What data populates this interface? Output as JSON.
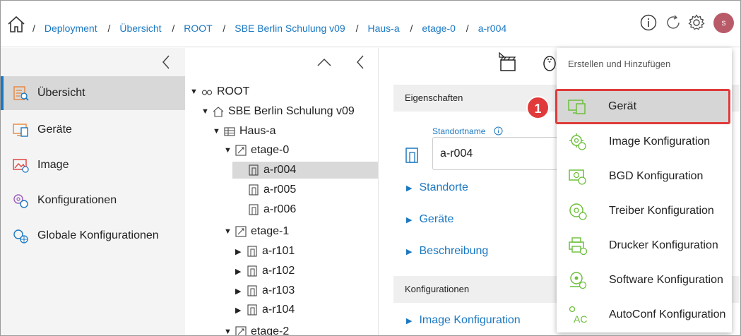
{
  "header": {
    "breadcrumb": [
      "Deployment",
      "Übersicht",
      "ROOT",
      "SBE Berlin Schulung v09",
      "Haus-a",
      "etage-0",
      "a-r004"
    ],
    "avatar_initial": "s"
  },
  "sidebar": {
    "items": [
      {
        "label": "Übersicht",
        "icon": "overview-icon",
        "active": true
      },
      {
        "label": "Geräte",
        "icon": "devices-icon"
      },
      {
        "label": "Image",
        "icon": "image-icon"
      },
      {
        "label": "Konfigurationen",
        "icon": "config-gears-icon"
      },
      {
        "label": "Globale Konfigurationen",
        "icon": "global-config-icon"
      }
    ]
  },
  "tree": {
    "root": "ROOT",
    "site": "SBE Berlin Schulung v09",
    "building": "Haus-a",
    "floor0": "etage-0",
    "f0rooms": [
      "a-r004",
      "a-r005",
      "a-r006"
    ],
    "floor1": "etage-1",
    "f1rooms": [
      "a-r101",
      "a-r102",
      "a-r103",
      "a-r104"
    ],
    "floor2": "etage-2"
  },
  "content": {
    "properties_header": "Eigenschaften",
    "field_label": "Standortname",
    "field_value": "a-r004",
    "sections": [
      "Standorte",
      "Geräte",
      "Beschreibung"
    ],
    "config_header": "Konfigurationen",
    "config_sections": [
      "Image Konfiguration"
    ]
  },
  "menu": {
    "title": "Erstellen und Hinzufügen",
    "items": [
      {
        "label": "Gerät",
        "icon": "device-add-icon"
      },
      {
        "label": "Image Konfiguration",
        "icon": "image-config-icon"
      },
      {
        "label": "BGD Konfiguration",
        "icon": "bgd-config-icon"
      },
      {
        "label": "Treiber Konfiguration",
        "icon": "driver-config-icon"
      },
      {
        "label": "Drucker Konfiguration",
        "icon": "printer-config-icon"
      },
      {
        "label": "Software Konfiguration",
        "icon": "software-config-icon"
      },
      {
        "label": "AutoConf Konfiguration",
        "icon": "autoconf-config-icon"
      }
    ]
  },
  "callout_number": "1",
  "colors": {
    "accent": "#1a78c2",
    "highlight": "#e03a3a",
    "icon_green": "#6cbf3a",
    "icon_orange": "#e8843a"
  }
}
